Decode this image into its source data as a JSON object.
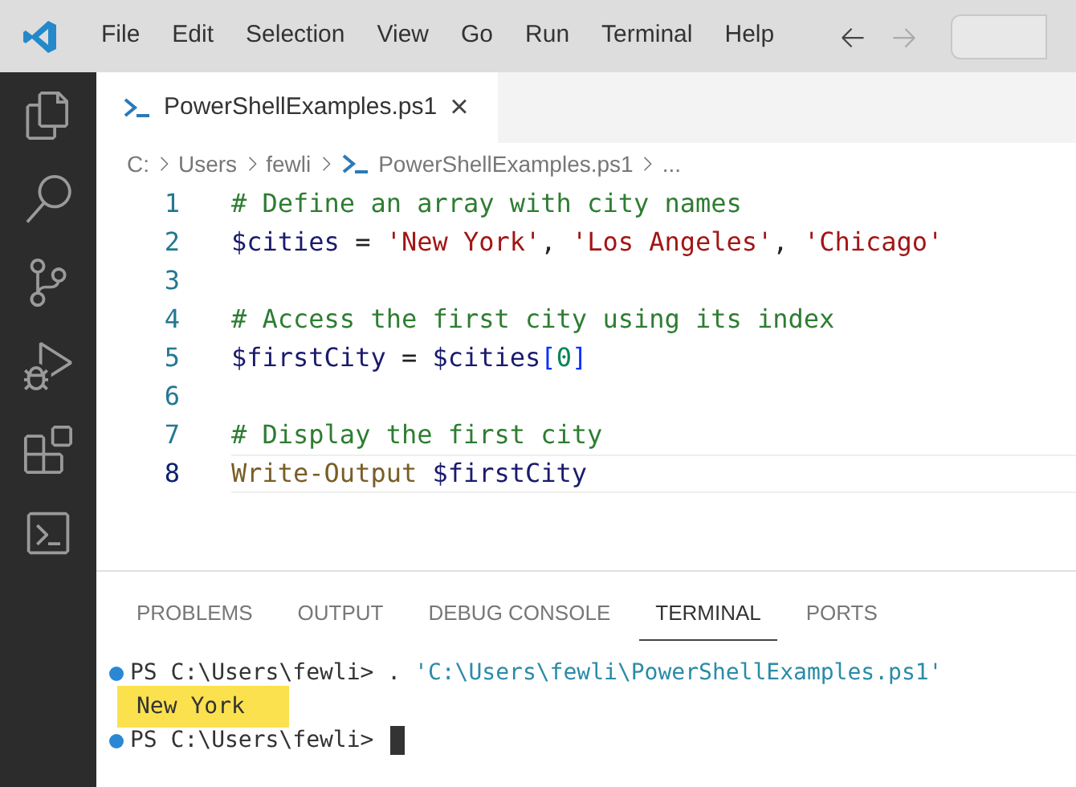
{
  "menu": [
    "File",
    "Edit",
    "Selection",
    "View",
    "Go",
    "Run",
    "Terminal",
    "Help"
  ],
  "editor_tabs": [
    {
      "label": "PowerShellExamples.ps1",
      "selected": true,
      "close": "×"
    }
  ],
  "breadcrumb": [
    "C:",
    "Users",
    "fewli",
    "PowerShellExamples.ps1",
    "..."
  ],
  "code": [
    {
      "number": "1",
      "current": false,
      "tokens": [
        {
          "kind": "comment",
          "text": "# Define an array with city names"
        }
      ]
    },
    {
      "number": "2",
      "current": false,
      "tokens": [
        {
          "kind": "variable",
          "text": "$cities"
        },
        {
          "kind": "plain",
          "text": " = "
        },
        {
          "kind": "string",
          "text": "'New York'"
        },
        {
          "kind": "plain",
          "text": ", "
        },
        {
          "kind": "string",
          "text": "'Los Angeles'"
        },
        {
          "kind": "plain",
          "text": ", "
        },
        {
          "kind": "string",
          "text": "'Chicago'"
        }
      ]
    },
    {
      "number": "3",
      "current": false
    },
    {
      "number": "4",
      "current": false,
      "tokens": [
        {
          "kind": "comment",
          "text": "# Access the first city using its index"
        }
      ]
    },
    {
      "number": "5",
      "current": false,
      "tokens": [
        {
          "kind": "variable",
          "text": "$firstCity"
        },
        {
          "kind": "plain",
          "text": " = "
        },
        {
          "kind": "variable",
          "text": "$cities"
        },
        {
          "kind": "bracket",
          "text": "["
        },
        {
          "kind": "number",
          "text": "0"
        },
        {
          "kind": "bracket",
          "text": "]"
        }
      ]
    },
    {
      "number": "6",
      "current": false
    },
    {
      "number": "7",
      "current": false,
      "tokens": [
        {
          "kind": "comment",
          "text": "# Display the first city"
        }
      ]
    },
    {
      "number": "8",
      "current": true,
      "tokens": [
        {
          "kind": "command",
          "text": "Write-Output"
        },
        {
          "kind": "variable",
          "text": "$firstCity"
        }
      ]
    }
  ],
  "panel_tabs": [
    {
      "label": "PROBLEMS",
      "selected": false
    },
    {
      "label": "OUTPUT",
      "selected": false
    },
    {
      "label": "DEBUG CONSOLE",
      "selected": false
    },
    {
      "label": "TERMINAL",
      "selected": true
    },
    {
      "label": "PORTS",
      "selected": false
    }
  ],
  "terminal": [
    {
      "kind": "prompt",
      "prompt": "PS C:\\Users\\fewli>",
      "command": ". ",
      "argument": "'C:\\Users\\fewli\\PowerShellExamples.ps1'",
      "cursor": false
    },
    {
      "kind": "output",
      "text": "New York",
      "highlighted": true
    },
    {
      "kind": "prompt",
      "prompt": "PS C:\\Users\\fewli>",
      "cursor": true
    }
  ]
}
